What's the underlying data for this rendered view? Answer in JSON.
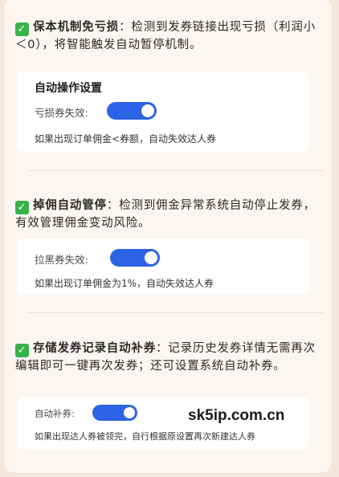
{
  "sections": [
    {
      "title": "保本机制免亏损",
      "description": "：检测到发券链接出现亏损（利润小＜0），将智能触发自动暂停机制。"
    },
    {
      "title": "掉佣自动管停",
      "description": "：检测到佣金异常系统自动停止发券，有效管理佣金变动风险。"
    },
    {
      "title": "存储发券记录自动补券",
      "description": "：记录历史发券详情无需再次编辑即可一键再次发券；还可设置系统自动补券。"
    }
  ],
  "cards": [
    {
      "title": "自动操作设置",
      "toggle_label": "亏损券失效:",
      "toggle_on": true,
      "note": "如果出现订单佣金<券额，自动失效达人券"
    },
    {
      "title": "",
      "toggle_label": "拉黑券失效:",
      "toggle_on": true,
      "note": "如果出现订单佣金为1%，自动失效达人券"
    },
    {
      "title": "",
      "toggle_label": "自动补券:",
      "toggle_on": true,
      "note": "如果出现达人券被领完，自行根据原设置再次新建达人券"
    }
  ],
  "watermark": "sk5ip.com.cn",
  "colors": {
    "toggle_on": "#2c63e6",
    "check": "#38b349",
    "background": "#f4e7dd"
  },
  "icons": [
    "check-mark-icon"
  ]
}
